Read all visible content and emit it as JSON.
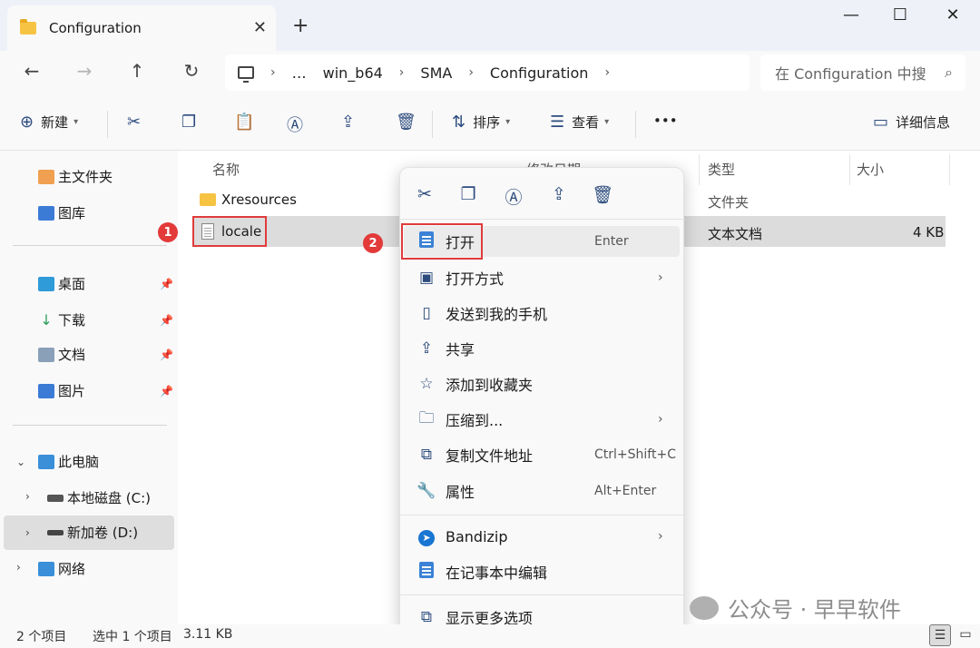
{
  "window": {
    "tab_title": "Configuration",
    "tab_close": "✕",
    "new_tab": "+",
    "minimize": "—",
    "maximize": "☐",
    "close": "✕"
  },
  "nav": {
    "back": "←",
    "forward": "→",
    "up": "↑",
    "refresh": "↻",
    "breadcrumb": [
      "…",
      "win_b64",
      "SMA",
      "Configuration"
    ],
    "search_placeholder": "在 Configuration 中搜"
  },
  "toolbar": {
    "new_label": "新建",
    "sort_label": "排序",
    "view_label": "查看",
    "more": "•••",
    "details_label": "详细信息"
  },
  "sidebar": {
    "home": "主文件夹",
    "gallery": "图库",
    "desktop": "桌面",
    "downloads": "下载",
    "documents": "文档",
    "pictures": "图片",
    "this_pc": "此电脑",
    "drive_c": "本地磁盘 (C:)",
    "drive_d": "新加卷 (D:)",
    "network": "网络"
  },
  "list": {
    "columns": {
      "name": "名称",
      "date": "修改日期",
      "type": "类型",
      "size": "大小"
    },
    "rows": [
      {
        "name": "Xresources",
        "type": "文件夹",
        "size": ""
      },
      {
        "name": "locale",
        "type": "文本文档",
        "size": "4 KB"
      }
    ]
  },
  "badges": {
    "one": "1",
    "two": "2"
  },
  "context_menu": {
    "open": "打开",
    "open_shortcut": "Enter",
    "open_with": "打开方式",
    "send_to_phone": "发送到我的手机",
    "share": "共享",
    "add_favorites": "添加到收藏夹",
    "compress_to": "压缩到...",
    "copy_path": "复制文件地址",
    "copy_path_shortcut": "Ctrl+Shift+C",
    "properties": "属性",
    "properties_shortcut": "Alt+Enter",
    "bandizip": "Bandizip",
    "edit_notepad": "在记事本中编辑",
    "more_options": "显示更多选项"
  },
  "watermark": {
    "text": "公众号 · 早早软件"
  },
  "status": {
    "items_count": "2 个项目",
    "selected": "选中 1 个项目",
    "size": "3.11 KB"
  }
}
